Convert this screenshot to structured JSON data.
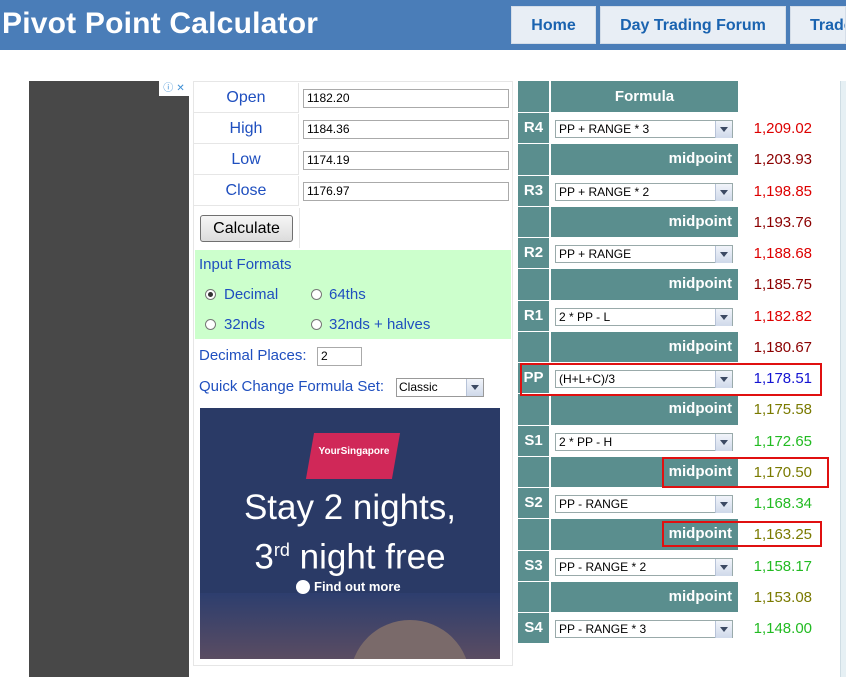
{
  "header": {
    "title": "Pivot Point Calculator",
    "nav": [
      "Home",
      "Day Trading Forum",
      "Trade"
    ]
  },
  "inputs": {
    "rows": [
      {
        "label": "Open",
        "value": "1182.20"
      },
      {
        "label": "High",
        "value": "1184.36"
      },
      {
        "label": "Low",
        "value": "1174.19"
      },
      {
        "label": "Close",
        "value": "1176.97"
      }
    ],
    "calculate_label": "Calculate",
    "formats_title": "Input Formats",
    "formats": [
      {
        "label": "Decimal",
        "checked": true
      },
      {
        "label": "64ths",
        "checked": false
      },
      {
        "label": "32nds",
        "checked": false
      },
      {
        "label": "32nds + halves",
        "checked": false
      }
    ],
    "decimal_places_label": "Decimal Places:",
    "decimal_places_value": "2",
    "formula_set_label": "Quick Change Formula Set:",
    "formula_set_value": "Classic"
  },
  "ad": {
    "logo_text": "YourSingapore",
    "headline_1": "Stay 2 nights,",
    "headline_2_pre": "3",
    "headline_2_sup": "rd",
    "headline_2_post": " night free",
    "cta": "Find out more"
  },
  "formula_table": {
    "header": "Formula",
    "midpoint_label": "midpoint",
    "rows": [
      {
        "label": "R4",
        "formula": "PP + RANGE * 3",
        "value": "1,209.02",
        "color": "#dd0000",
        "mid": "1,203.93",
        "mid_color": "#8b0000"
      },
      {
        "label": "R3",
        "formula": "PP + RANGE * 2",
        "value": "1,198.85",
        "color": "#dd0000",
        "mid": "1,193.76",
        "mid_color": "#8b0000"
      },
      {
        "label": "R2",
        "formula": "PP + RANGE",
        "value": "1,188.68",
        "color": "#dd0000",
        "mid": "1,185.75",
        "mid_color": "#8b0000"
      },
      {
        "label": "R1",
        "formula": "2 * PP - L",
        "value": "1,182.82",
        "color": "#dd0000",
        "mid": "1,180.67",
        "mid_color": "#8b0000"
      },
      {
        "label": "PP",
        "formula": "(H+L+C)/3",
        "value": "1,178.51",
        "color": "#1414d2",
        "mid": "1,175.58",
        "mid_color": "#7a7a00"
      },
      {
        "label": "S1",
        "formula": "2 * PP - H",
        "value": "1,172.65",
        "color": "#22bb22",
        "mid": "1,170.50",
        "mid_color": "#7a7a00"
      },
      {
        "label": "S2",
        "formula": "PP - RANGE",
        "value": "1,168.34",
        "color": "#22bb22",
        "mid": "1,163.25",
        "mid_color": "#7a7a00"
      },
      {
        "label": "S3",
        "formula": "PP - RANGE * 2",
        "value": "1,158.17",
        "color": "#22bb22",
        "mid": "1,153.08",
        "mid_color": "#7a7a00"
      },
      {
        "label": "S4",
        "formula": "PP - RANGE * 3",
        "value": "1,148.00",
        "color": "#22bb22",
        "mid": null,
        "mid_color": null
      }
    ]
  }
}
